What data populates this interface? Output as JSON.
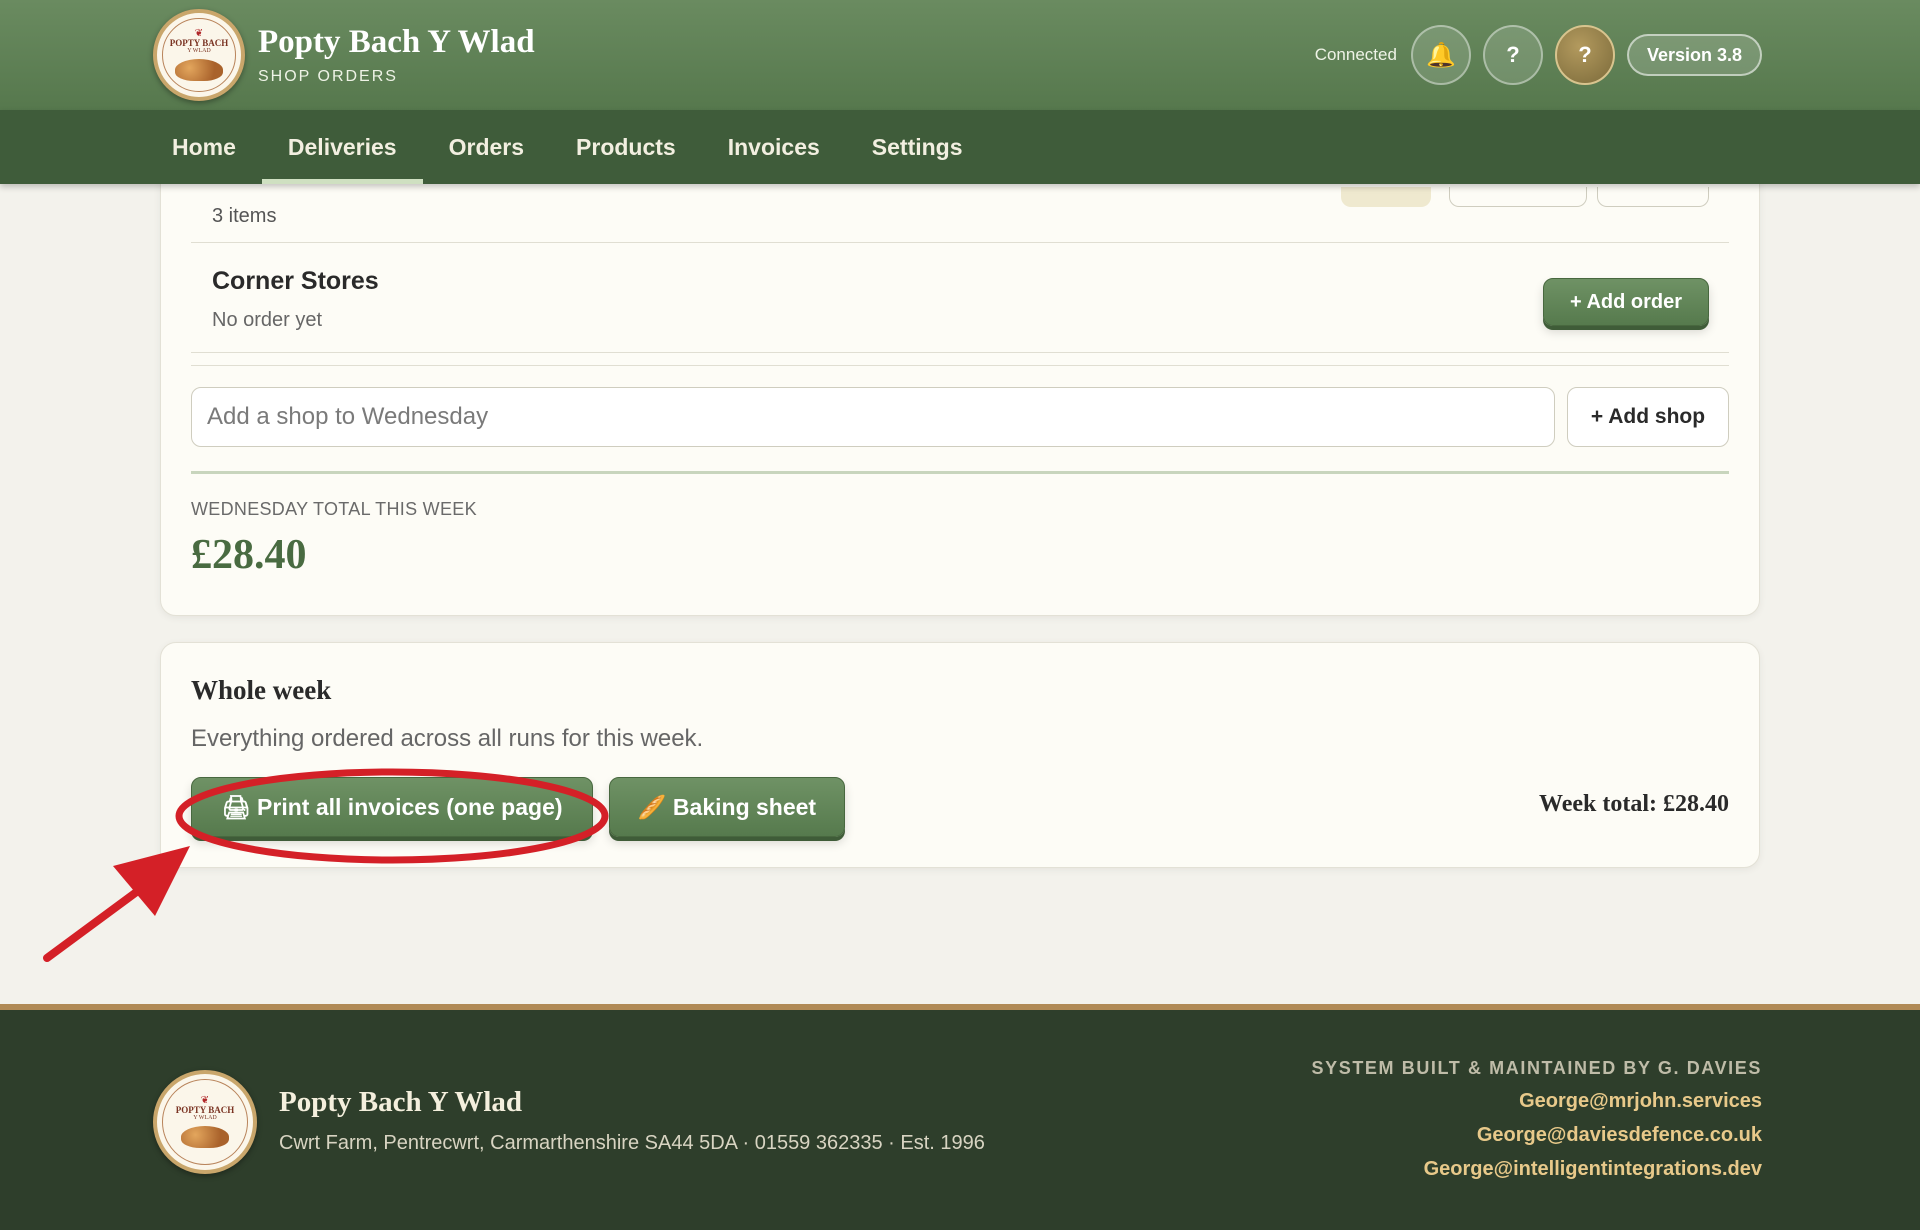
{
  "header": {
    "title": "Popty Bach Y Wlad",
    "subtitle": "SHOP ORDERS",
    "logo_text": "POPTY BACH",
    "logo_subtext": "Y WLAD",
    "status": "Connected",
    "bell_icon": "🔔",
    "help_label": "?",
    "avatar_label": "?",
    "version": "Version 3.8"
  },
  "nav": {
    "items": [
      "Home",
      "Deliveries",
      "Orders",
      "Products",
      "Invoices",
      "Settings"
    ],
    "active": "Deliveries"
  },
  "day_card": {
    "previous_shop_items": "3 items",
    "shop": {
      "name": "Corner Stores",
      "status": "No order yet",
      "add_order_label": "+ Add order"
    },
    "add_shop_placeholder": "Add a shop to Wednesday",
    "add_shop_label": "+ Add shop",
    "total_label": "WEDNESDAY TOTAL THIS WEEK",
    "total_value": "£28.40"
  },
  "week_card": {
    "title": "Whole week",
    "description": "Everything ordered across all runs for this week.",
    "print_label": "🖨 Print all invoices (one page)",
    "baking_label": "🥖 Baking sheet",
    "week_total": "Week total: £28.40"
  },
  "footer": {
    "brand": "Popty Bach Y Wlad",
    "address": "Cwrt Farm, Pentrecwrt, Carmarthenshire SA44 5DA · 01559 362335 · Est. 1996",
    "credit": "SYSTEM BUILT & MAINTAINED BY G. DAVIES",
    "emails": [
      "George@mrjohn.services",
      "George@daviesdefence.co.uk",
      "George@intelligentintegrations.dev"
    ]
  },
  "colors": {
    "header_green": "#6a8b60",
    "nav_green": "#3f5c3a",
    "button_green": "#6f9265",
    "total_green": "#496b41",
    "footer_green": "#2e3e2b",
    "footer_link": "#e8c98a",
    "annotation_red": "#d42027"
  }
}
